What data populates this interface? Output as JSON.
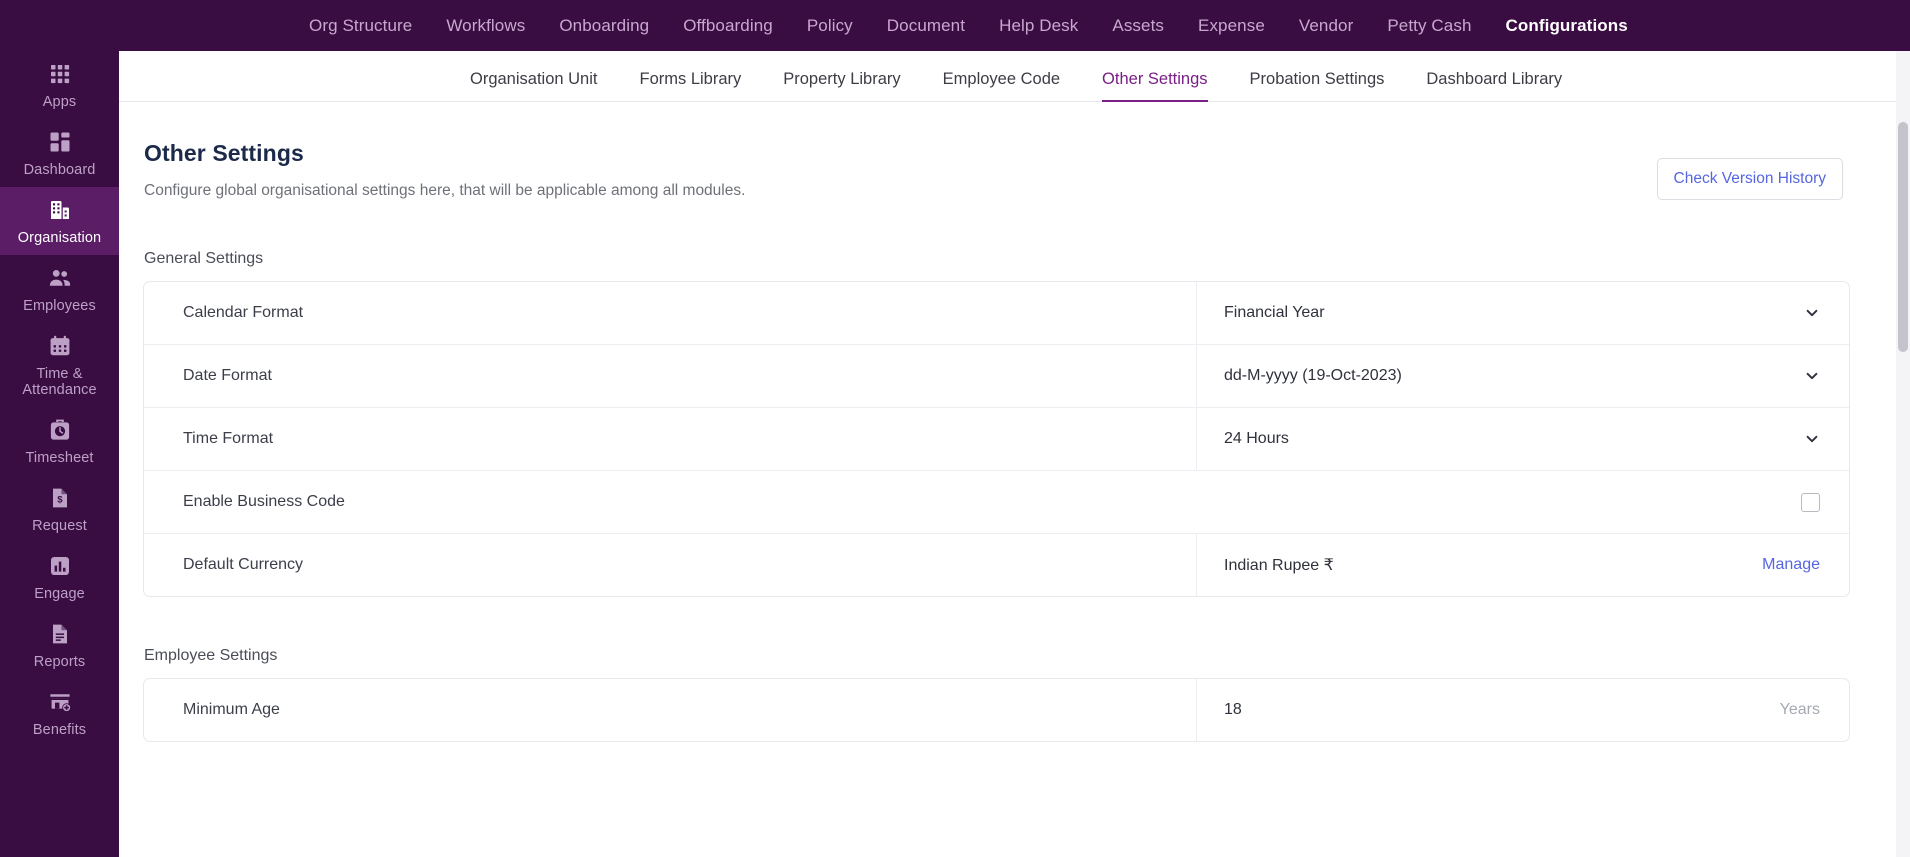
{
  "topnav": {
    "items": [
      {
        "label": "Org Structure",
        "active": false
      },
      {
        "label": "Workflows",
        "active": false
      },
      {
        "label": "Onboarding",
        "active": false
      },
      {
        "label": "Offboarding",
        "active": false
      },
      {
        "label": "Policy",
        "active": false
      },
      {
        "label": "Document",
        "active": false
      },
      {
        "label": "Help Desk",
        "active": false
      },
      {
        "label": "Assets",
        "active": false
      },
      {
        "label": "Expense",
        "active": false
      },
      {
        "label": "Vendor",
        "active": false
      },
      {
        "label": "Petty Cash",
        "active": false
      },
      {
        "label": "Configurations",
        "active": true
      }
    ]
  },
  "sidebar": {
    "items": [
      {
        "label": "Apps",
        "icon": "grid-apps-icon",
        "active": false
      },
      {
        "label": "Dashboard",
        "icon": "dashboard-icon",
        "active": false
      },
      {
        "label": "Organisation",
        "icon": "building-icon",
        "active": true
      },
      {
        "label": "Employees",
        "icon": "people-icon",
        "active": false
      },
      {
        "label": "Time & Attendance",
        "icon": "calendar-icon",
        "active": false
      },
      {
        "label": "Timesheet",
        "icon": "clock-bag-icon",
        "active": false
      },
      {
        "label": "Request",
        "icon": "money-document-icon",
        "active": false
      },
      {
        "label": "Engage",
        "icon": "bar-chart-icon",
        "active": false
      },
      {
        "label": "Reports",
        "icon": "report-document-icon",
        "active": false
      },
      {
        "label": "Benefits",
        "icon": "store-plus-icon",
        "active": false
      }
    ]
  },
  "tabs": [
    {
      "label": "Organisation Unit",
      "active": false
    },
    {
      "label": "Forms Library",
      "active": false
    },
    {
      "label": "Property Library",
      "active": false
    },
    {
      "label": "Employee Code",
      "active": false
    },
    {
      "label": "Other Settings",
      "active": true
    },
    {
      "label": "Probation Settings",
      "active": false
    },
    {
      "label": "Dashboard Library",
      "active": false
    }
  ],
  "page": {
    "title": "Other Settings",
    "subtitle": "Configure global organisational settings here, that will be applicable among all modules.",
    "version_button": "Check Version History"
  },
  "sections": [
    {
      "label": "General Settings",
      "rows": [
        {
          "label": "Calendar Format",
          "value": "Financial Year",
          "control": "select"
        },
        {
          "label": "Date Format",
          "value": "dd-M-yyyy (19-Oct-2023)",
          "control": "select"
        },
        {
          "label": "Time Format",
          "value": "24 Hours",
          "control": "select"
        },
        {
          "label": "Enable Business Code",
          "value": "",
          "control": "checkbox",
          "checked": false,
          "no_divider": true
        },
        {
          "label": "Default Currency",
          "value": "Indian Rupee ₹",
          "control": "link",
          "action_label": "Manage"
        }
      ]
    },
    {
      "label": "Employee Settings",
      "rows": [
        {
          "label": "Minimum Age",
          "value": "18",
          "control": "unit",
          "unit": "Years"
        }
      ]
    }
  ],
  "colors": {
    "brand_purple": "#3a0d42",
    "active_purple": "#5a1d66",
    "tab_accent": "#7a1f86",
    "link_blue": "#5566e0",
    "title_navy": "#1c2a4a"
  }
}
